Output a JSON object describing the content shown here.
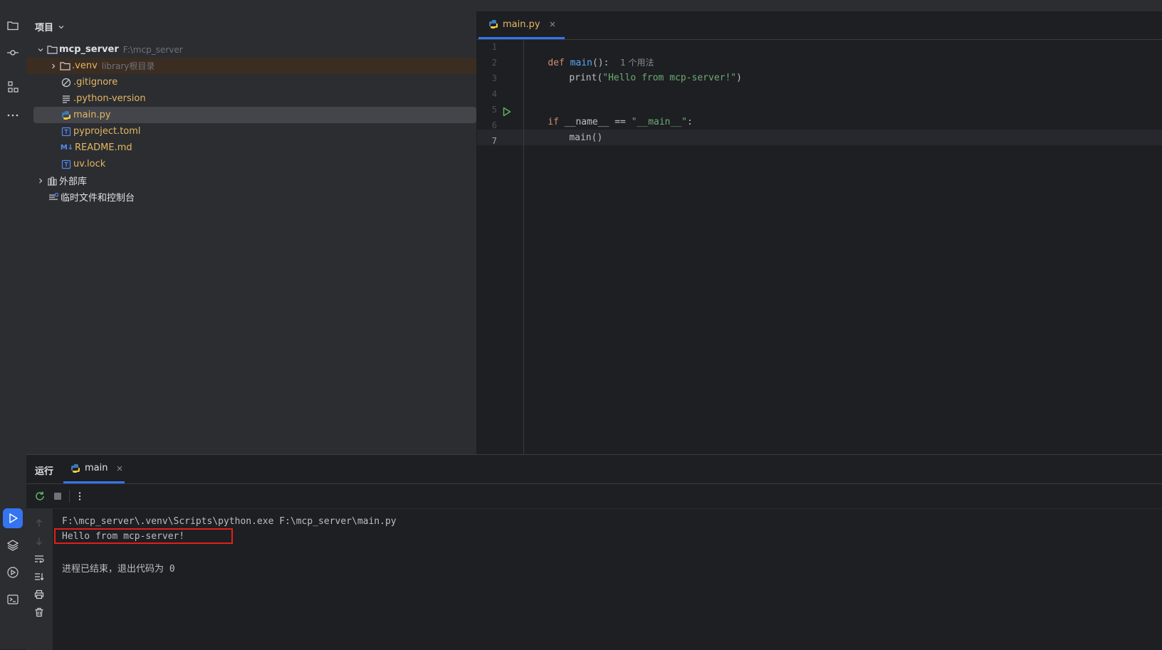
{
  "project_panel": {
    "title": "项目",
    "tree": [
      {
        "name": "mcp_server",
        "hint": "F:\\mcp_server",
        "icon": "folder-icon"
      },
      {
        "name": ".venv",
        "hint": "library根目录",
        "icon": "folder-icon"
      },
      {
        "name": ".gitignore",
        "icon": "ignore-file-icon"
      },
      {
        "name": ".python-version",
        "icon": "text-file-icon"
      },
      {
        "name": "main.py",
        "icon": "python-file-icon"
      },
      {
        "name": "pyproject.toml",
        "icon": "toml-file-icon"
      },
      {
        "name": "README.md",
        "icon": "markdown-file-icon"
      },
      {
        "name": "uv.lock",
        "icon": "lock-file-icon"
      },
      {
        "name": "外部库",
        "icon": "library-icon"
      },
      {
        "name": "临时文件和控制台",
        "icon": "scratches-icon"
      }
    ]
  },
  "editor": {
    "tab_label": "main.py",
    "line_numbers": [
      "1",
      "2",
      "3",
      "4",
      "5",
      "6",
      "7"
    ],
    "usage_hint": "1 个用法",
    "code": {
      "l1_kw": "def",
      "l1_fn": "main",
      "l1_rest": "():",
      "l2_plain1": "print(",
      "l2_str": "\"Hello from mcp-server!\"",
      "l2_plain2": ")",
      "l5_kw": "if",
      "l5_plain": " __name__ == ",
      "l5_str": "\"__main__\"",
      "l5_colon": ":",
      "l6_plain": "main()"
    }
  },
  "run_panel": {
    "title": "运行",
    "tab_label": "main",
    "console": [
      "F:\\mcp_server\\.venv\\Scripts\\python.exe F:\\mcp_server\\main.py",
      "Hello from mcp-server!",
      "",
      "进程已结束，退出代码为 0"
    ]
  },
  "colors": {
    "accent": "#3574f0",
    "highlight_box": "#e0201b",
    "selected_row": "#43454a",
    "venv_row": "#3b2d22"
  }
}
